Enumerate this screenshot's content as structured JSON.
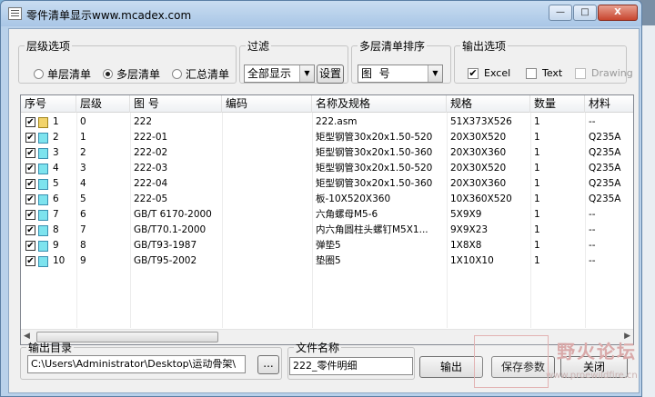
{
  "window": {
    "title": "零件清单显示www.mcadex.com",
    "controls": [
      "—",
      "□",
      "X"
    ]
  },
  "level_group": {
    "legend": "层级选项",
    "options": [
      "单层清单",
      "多层清单",
      "汇总清单"
    ],
    "selected": "多层清单"
  },
  "filter_group": {
    "legend": "过滤",
    "value": "全部显示",
    "button": "设置"
  },
  "sort_group": {
    "legend": "多层清单排序",
    "value": "图  号"
  },
  "output_group": {
    "legend": "输出选项",
    "options": [
      {
        "label": "Excel",
        "checked": true,
        "enabled": true
      },
      {
        "label": "Text",
        "checked": false,
        "enabled": true
      },
      {
        "label": "Drawing",
        "checked": false,
        "enabled": false
      }
    ]
  },
  "table": {
    "columns": [
      "序号",
      "层级",
      "图  号",
      "编码",
      "名称及规格",
      "规格",
      "数量",
      "材料"
    ],
    "rows": [
      {
        "seq": "1",
        "level": "0",
        "drawing": "222",
        "code": "",
        "name": "222.asm",
        "spec": "51X373X526",
        "qty": "1",
        "material": "--",
        "icon": "asm"
      },
      {
        "seq": "2",
        "level": "1",
        "drawing": "222-01",
        "code": "",
        "name": "矩型钢管30x20x1.50-520",
        "spec": "20X30X520",
        "qty": "1",
        "material": "Q235A",
        "icon": "part"
      },
      {
        "seq": "3",
        "level": "2",
        "drawing": "222-02",
        "code": "",
        "name": "矩型钢管30x20x1.50-360",
        "spec": "20X30X360",
        "qty": "1",
        "material": "Q235A",
        "icon": "part"
      },
      {
        "seq": "4",
        "level": "3",
        "drawing": "222-03",
        "code": "",
        "name": "矩型钢管30x20x1.50-520",
        "spec": "20X30X520",
        "qty": "1",
        "material": "Q235A",
        "icon": "part"
      },
      {
        "seq": "5",
        "level": "4",
        "drawing": "222-04",
        "code": "",
        "name": "矩型钢管30x20x1.50-360",
        "spec": "20X30X360",
        "qty": "1",
        "material": "Q235A",
        "icon": "part"
      },
      {
        "seq": "6",
        "level": "5",
        "drawing": "222-05",
        "code": "",
        "name": "板-10X520X360",
        "spec": "10X360X520",
        "qty": "1",
        "material": "Q235A",
        "icon": "part"
      },
      {
        "seq": "7",
        "level": "6",
        "drawing": "GB/T 6170-2000",
        "code": "",
        "name": "六角螺母M5-6",
        "spec": "5X9X9",
        "qty": "1",
        "material": "--",
        "icon": "part"
      },
      {
        "seq": "8",
        "level": "7",
        "drawing": "GB/T70.1-2000",
        "code": "",
        "name": "内六角圆柱头螺钉M5X1...",
        "spec": "9X9X23",
        "qty": "1",
        "material": "--",
        "icon": "part"
      },
      {
        "seq": "9",
        "level": "8",
        "drawing": "GB/T93-1987",
        "code": "",
        "name": "弹垫5",
        "spec": "1X8X8",
        "qty": "1",
        "material": "--",
        "icon": "part"
      },
      {
        "seq": "10",
        "level": "9",
        "drawing": "GB/T95-2002",
        "code": "",
        "name": "垫圈5",
        "spec": "1X10X10",
        "qty": "1",
        "material": "--",
        "icon": "part"
      }
    ]
  },
  "output_dir": {
    "label": "输出目录",
    "value": "C:\\Users\\Administrator\\Desktop\\运动骨架\\",
    "browse": "..."
  },
  "file_name": {
    "label": "文件名称",
    "value": "222_零件明细"
  },
  "buttons": {
    "output": "输出",
    "save_params": "保存参数",
    "close": "关闭"
  },
  "watermark": {
    "text": "野火论坛",
    "url": "www.proewildfire.cn"
  }
}
